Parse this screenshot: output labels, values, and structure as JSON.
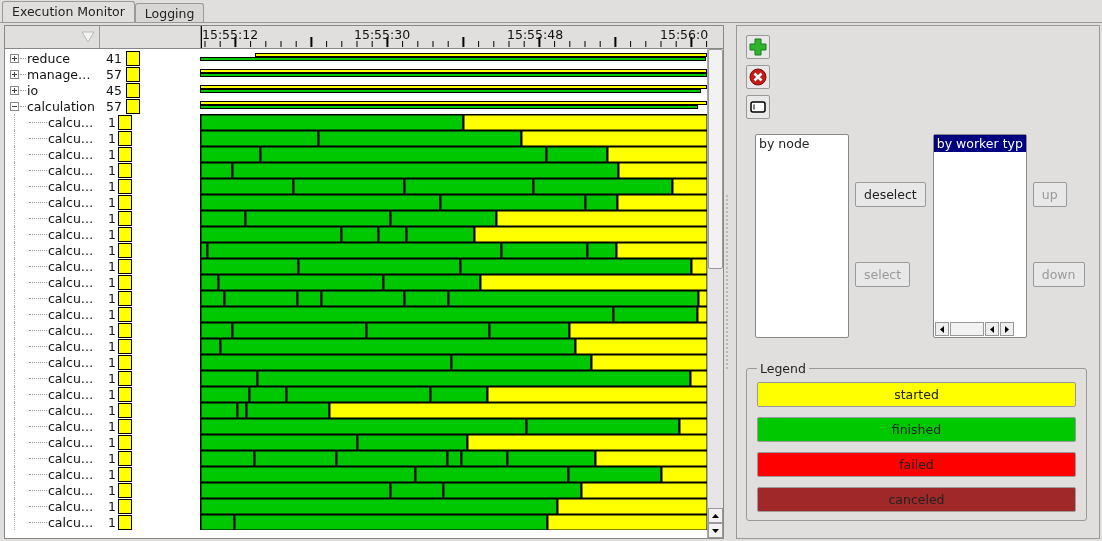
{
  "tabs": [
    {
      "label": "Execution Monitor",
      "selected": true
    },
    {
      "label": "Logging",
      "selected": false
    }
  ],
  "timeline": {
    "ticks": [
      "15:55:12",
      "15:55:30",
      "15:55:48",
      "15:56:0"
    ]
  },
  "tree": [
    {
      "label": "reduce",
      "count": "41",
      "expanded": false
    },
    {
      "label": "manage…",
      "count": "57",
      "expanded": false
    },
    {
      "label": "io",
      "count": "45",
      "expanded": false
    },
    {
      "label": "calculation",
      "count": "57",
      "expanded": true,
      "children": [
        {
          "label": "calcu…",
          "count": "1"
        },
        {
          "label": "calcu…",
          "count": "1"
        },
        {
          "label": "calcu…",
          "count": "1"
        },
        {
          "label": "calcu…",
          "count": "1"
        },
        {
          "label": "calcu…",
          "count": "1"
        },
        {
          "label": "calcu…",
          "count": "1"
        },
        {
          "label": "calcu…",
          "count": "1"
        },
        {
          "label": "calcu…",
          "count": "1"
        },
        {
          "label": "calcu…",
          "count": "1"
        },
        {
          "label": "calcu…",
          "count": "1"
        },
        {
          "label": "calcu…",
          "count": "1"
        },
        {
          "label": "calcu…",
          "count": "1"
        },
        {
          "label": "calcu…",
          "count": "1"
        },
        {
          "label": "calcu…",
          "count": "1"
        },
        {
          "label": "calcu…",
          "count": "1"
        },
        {
          "label": "calcu…",
          "count": "1"
        },
        {
          "label": "calcu…",
          "count": "1"
        },
        {
          "label": "calcu…",
          "count": "1"
        },
        {
          "label": "calcu…",
          "count": "1"
        },
        {
          "label": "calcu…",
          "count": "1"
        },
        {
          "label": "calcu…",
          "count": "1"
        },
        {
          "label": "calcu…",
          "count": "1"
        },
        {
          "label": "calcu…",
          "count": "1"
        },
        {
          "label": "calcu…",
          "count": "1"
        },
        {
          "label": "calcu…",
          "count": "1"
        },
        {
          "label": "calcu…",
          "count": "1"
        }
      ]
    }
  ],
  "available_list": {
    "items": [
      {
        "label": "by node",
        "selected": false
      }
    ]
  },
  "chosen_list": {
    "items": [
      {
        "label": "by worker typ",
        "selected": true
      }
    ]
  },
  "buttons": [
    {
      "label": "deselect",
      "disabled": false
    },
    {
      "label": "select",
      "disabled": true
    },
    {
      "label": "up",
      "disabled": true
    },
    {
      "label": "down",
      "disabled": true
    }
  ],
  "legend": {
    "title": "Legend",
    "items": [
      {
        "label": "started",
        "color": "#ffff00"
      },
      {
        "label": "finished",
        "color": "#00c800"
      },
      {
        "label": "failed",
        "color": "#ff0000"
      },
      {
        "label": "canceled",
        "color": "#a02828"
      }
    ]
  }
}
